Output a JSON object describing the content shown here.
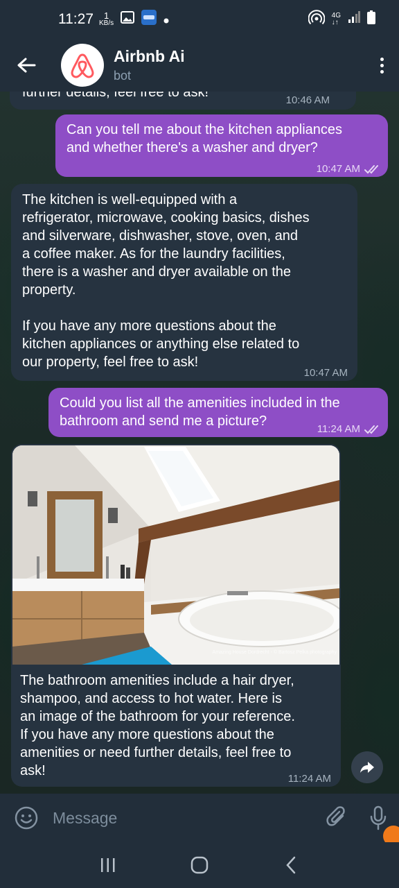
{
  "status_bar": {
    "time": "11:27",
    "net_speed_value": "1",
    "net_speed_unit": "KB/s",
    "network": "4G",
    "icons": [
      "image-icon",
      "app-icon",
      "dot-icon",
      "hotspot-icon",
      "signal-icon",
      "battery-icon"
    ]
  },
  "header": {
    "title": "Airbnb Ai",
    "subtitle": "bot",
    "brand_color": "#ff5a5f"
  },
  "messages": [
    {
      "direction": "in",
      "text": "further details, feel free to ask!",
      "time": "10:46 AM"
    },
    {
      "direction": "out",
      "text": "Can you tell me about the kitchen appliances\nand whether there's a washer and dryer?",
      "time": "10:47 AM",
      "read": true
    },
    {
      "direction": "in",
      "text": "The kitchen is well-equipped with a\nrefrigerator, microwave, cooking basics, dishes\nand silverware, dishwasher, stove, oven, and\na coffee maker. As for the laundry facilities,\nthere is a washer and dryer available on the\nproperty.\n\nIf you have any more questions about the\nkitchen appliances or anything else related to\nour property, feel free to ask!",
      "time": "10:47 AM"
    },
    {
      "direction": "out",
      "text": "Could you list all the amenities included in the\nbathroom and send me a picture?",
      "time": "11:24 AM",
      "read": true
    },
    {
      "direction": "in",
      "photo_credit": "Amazing House Dordrecht - © Bartosz Pelka photography",
      "text": "The bathroom amenities include a hair dryer,\nshampoo, and access to hot water. Here is\nan image of the bathroom for your reference.\nIf you have any more questions about the\namenities or need further details, feel free to\nask!",
      "time": "11:24 AM"
    }
  ],
  "input_bar": {
    "placeholder": "Message"
  },
  "colors": {
    "outgoing_bubble": "#8e4ec6",
    "incoming_bubble": "#263340",
    "bar_background": "#222e3a"
  }
}
